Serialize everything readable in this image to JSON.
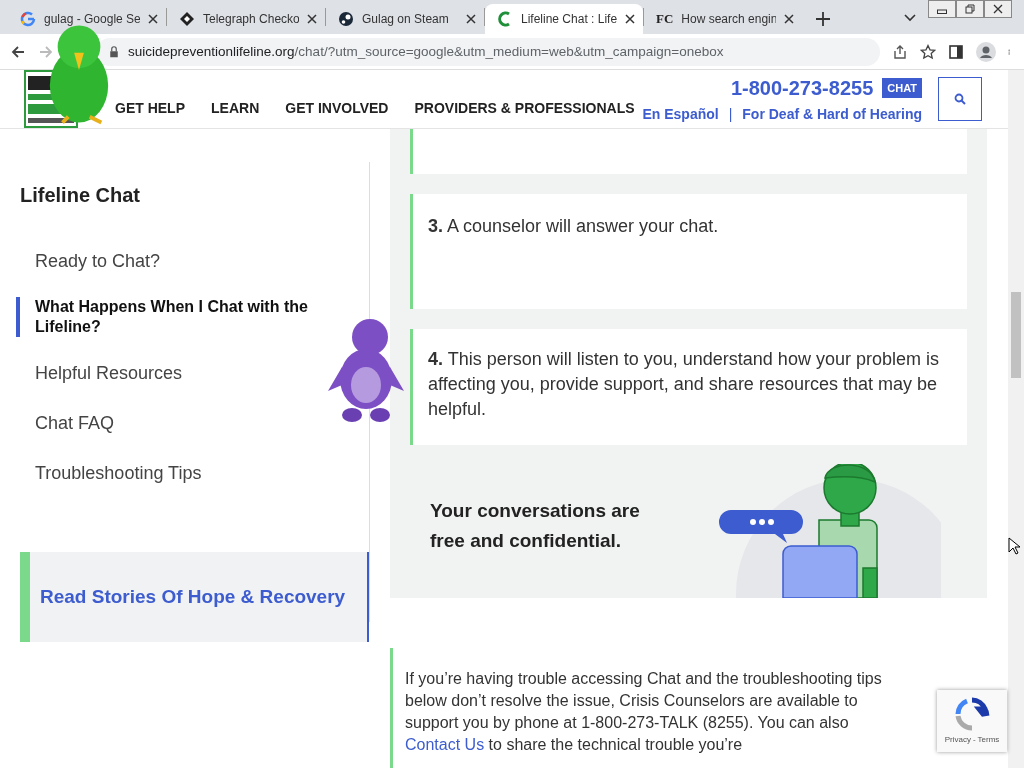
{
  "browser": {
    "tabs": [
      {
        "title": "gulag - Google Se",
        "kind": "google",
        "selected": false
      },
      {
        "title": "Telegraph Checko",
        "kind": "diamond",
        "selected": false
      },
      {
        "title": "Gulag on Steam",
        "kind": "steam",
        "selected": false
      },
      {
        "title": "Lifeline Chat : Life",
        "kind": "lifeline",
        "selected": true
      },
      {
        "title": "How search engin",
        "kind": "text",
        "favicon_text": "FC",
        "selected": false
      }
    ],
    "address": {
      "domain": "suicidepreventionlifeline.org",
      "path": "/chat/?utm_source=google&utm_medium=web&utm_campaign=onebox"
    }
  },
  "site_header": {
    "nav": [
      "GET HELP",
      "LEARN",
      "GET INVOLVED",
      "PROVIDERS & PROFESSIONALS"
    ],
    "phone": "1-800-273-8255",
    "chat_badge": "CHAT",
    "links": [
      "En Español",
      "For Deaf & Hard of Hearing"
    ],
    "separator": "|"
  },
  "sidebar": {
    "title": "Lifeline Chat",
    "items": [
      {
        "label": "Ready to Chat?",
        "selected": false
      },
      {
        "label": "What Happens When I Chat with the Lifeline?",
        "selected": true
      },
      {
        "label": "Helpful Resources",
        "selected": false
      },
      {
        "label": "Chat FAQ",
        "selected": false
      },
      {
        "label": "Troubleshooting Tips",
        "selected": false
      }
    ],
    "cta": "Read Stories Of Hope & Recovery"
  },
  "steps": [
    {
      "number": "3.",
      "text": "A counselor will answer your chat."
    },
    {
      "number": "4.",
      "text": "This person will listen to you, understand how your problem is affecting you, provide support, and share resources that may be helpful."
    }
  ],
  "banner": {
    "text": "Your conversations are free and confidential."
  },
  "notice": {
    "text_before": "If you’re having trouble accessing Chat and the troubleshooting tips below don’t resolve the issue, Crisis Counselors are available to support you by phone at 1-800-273-TALK (8255). You can also",
    "link": "Contact Us",
    "text_after": "to share the technical trouble you’re"
  },
  "recaptcha": {
    "links": [
      "Privacy",
      "Terms"
    ],
    "separator": "-"
  }
}
